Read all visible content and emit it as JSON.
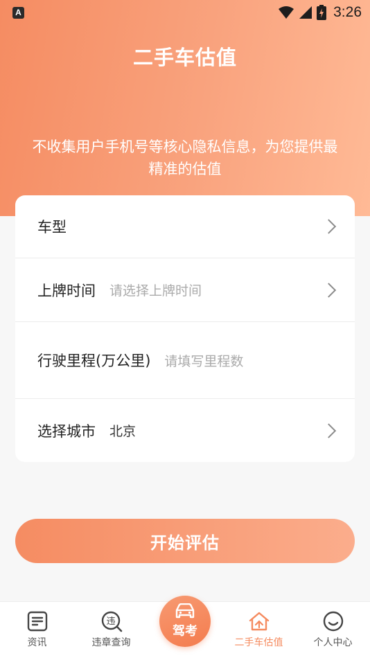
{
  "status_bar": {
    "app_icon_letter": "A",
    "time": "3:26"
  },
  "header": {
    "title": "二手车估值",
    "subtitle": "不收集用户手机号等核心隐私信息，为您提供最精准的估值"
  },
  "form": {
    "rows": [
      {
        "label": "车型",
        "value": "",
        "placeholder": ""
      },
      {
        "label": "上牌时间",
        "value": "",
        "placeholder": "请选择上牌时间"
      },
      {
        "label": "行驶里程(万公里)",
        "value": "",
        "placeholder": "请填写里程数"
      },
      {
        "label": "选择城市",
        "value": "北京",
        "placeholder": ""
      }
    ],
    "submit_label": "开始评估"
  },
  "bottom_nav": {
    "items": [
      {
        "label": "资讯",
        "icon": "news-icon"
      },
      {
        "label": "违章查询",
        "icon": "violation-search-icon",
        "icon_char": "违"
      },
      {
        "label": "驾考",
        "icon": "car-icon"
      },
      {
        "label": "二手车估值",
        "icon": "used-car-value-icon"
      },
      {
        "label": "个人中心",
        "icon": "smiley-icon"
      }
    ],
    "active_index": 3
  },
  "colors": {
    "accent": "#f58a5e",
    "gradient_start": "#f58c62",
    "gradient_end": "#ffba96"
  }
}
